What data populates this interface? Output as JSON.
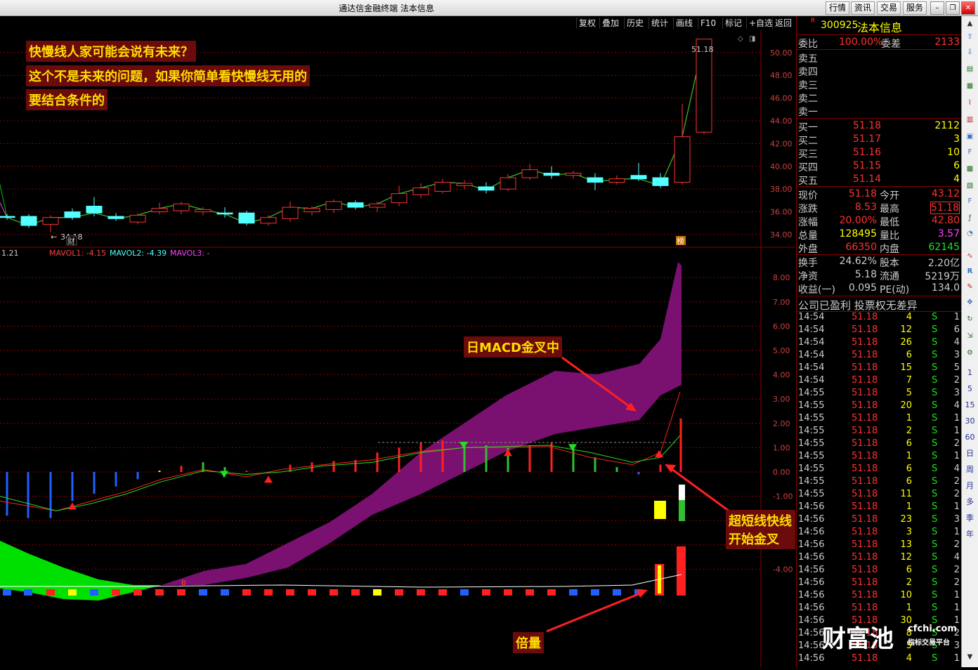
{
  "window": {
    "title": "通达信金融终端 法本信息"
  },
  "top_buttons": [
    "行情",
    "资讯",
    "交易",
    "服务"
  ],
  "toolbar": [
    "复权",
    "叠加",
    "历史",
    "统计",
    "画线",
    "F10",
    "标记",
    "+自选",
    "返回"
  ],
  "annotations": {
    "line1": "快慢线人家可能会说有未来？",
    "line2": "这个不是未来的问题，如果你简单看快慢线无用的",
    "line3": "要结合条件的",
    "macd": "日MACD金叉中",
    "short": "超短线快线开始金叉",
    "volume": "倍量"
  },
  "price_chart": {
    "high_label": "51.18",
    "low_label": "34.18",
    "y_ticks": [
      "50.00",
      "48.00",
      "46.00",
      "44.00",
      "42.00",
      "40.00",
      "38.00",
      "36.00",
      "34.00"
    ],
    "marker_left": "财",
    "marker_right": "榜",
    "candles": [
      {
        "o": 35.6,
        "c": 35.5,
        "h": 35.8,
        "l": 35.3
      },
      {
        "o": 35.6,
        "c": 34.8,
        "h": 35.8,
        "l": 34.6
      },
      {
        "o": 34.9,
        "c": 35.5,
        "h": 35.7,
        "l": 34.2
      },
      {
        "o": 36.0,
        "c": 35.5,
        "h": 36.3,
        "l": 35.3
      },
      {
        "o": 36.5,
        "c": 35.9,
        "h": 37.3,
        "l": 35.6
      },
      {
        "o": 35.6,
        "c": 35.4,
        "h": 35.9,
        "l": 35.2
      },
      {
        "o": 35.1,
        "c": 35.7,
        "h": 35.9,
        "l": 34.9
      },
      {
        "o": 36.0,
        "c": 36.3,
        "h": 36.8,
        "l": 35.8
      },
      {
        "o": 36.1,
        "c": 36.7,
        "h": 36.9,
        "l": 35.8
      },
      {
        "o": 36.0,
        "c": 36.2,
        "h": 36.4,
        "l": 35.7
      },
      {
        "o": 35.9,
        "c": 35.8,
        "h": 36.4,
        "l": 35.5
      },
      {
        "o": 35.9,
        "c": 35.0,
        "h": 36.1,
        "l": 34.8
      },
      {
        "o": 35.0,
        "c": 35.5,
        "h": 35.7,
        "l": 34.8
      },
      {
        "o": 35.4,
        "c": 36.4,
        "h": 36.9,
        "l": 35.1
      },
      {
        "o": 36.0,
        "c": 36.3,
        "h": 36.5,
        "l": 35.7
      },
      {
        "o": 36.2,
        "c": 36.9,
        "h": 37.1,
        "l": 35.9
      },
      {
        "o": 36.8,
        "c": 36.4,
        "h": 37.0,
        "l": 36.2
      },
      {
        "o": 36.4,
        "c": 36.7,
        "h": 36.9,
        "l": 36.0
      },
      {
        "o": 36.8,
        "c": 37.6,
        "h": 38.3,
        "l": 36.5
      },
      {
        "o": 37.5,
        "c": 38.1,
        "h": 38.5,
        "l": 37.2
      },
      {
        "o": 37.8,
        "c": 38.6,
        "h": 38.9,
        "l": 37.6
      },
      {
        "o": 38.3,
        "c": 38.5,
        "h": 38.8,
        "l": 38.0
      },
      {
        "o": 38.2,
        "c": 37.9,
        "h": 38.6,
        "l": 37.6
      },
      {
        "o": 38.0,
        "c": 39.0,
        "h": 39.3,
        "l": 37.8
      },
      {
        "o": 39.0,
        "c": 39.7,
        "h": 40.2,
        "l": 38.8
      },
      {
        "o": 39.4,
        "c": 39.2,
        "h": 40.0,
        "l": 38.9
      },
      {
        "o": 39.2,
        "c": 39.4,
        "h": 39.6,
        "l": 38.9
      },
      {
        "o": 39.0,
        "c": 38.6,
        "h": 39.4,
        "l": 37.9
      },
      {
        "o": 38.6,
        "c": 38.9,
        "h": 39.2,
        "l": 38.4
      },
      {
        "o": 39.2,
        "c": 38.9,
        "h": 40.3,
        "l": 38.7
      },
      {
        "o": 39.0,
        "c": 38.3,
        "h": 39.4,
        "l": 38.1
      },
      {
        "o": 38.6,
        "c": 42.6,
        "h": 45.5,
        "l": 38.4
      },
      {
        "o": 43.0,
        "c": 51.18,
        "h": 51.18,
        "l": 42.8
      }
    ]
  },
  "vol_panel": {
    "header_value": "1.21",
    "mavol1": "MAVOL1: -4.15",
    "mavol2": "MAVOL2: -4.39",
    "mavol3": "MAVOL3: -",
    "y_ticks": [
      "8.00",
      "7.00",
      "6.00",
      "5.00",
      "4.00",
      "3.00",
      "2.00",
      "1.00",
      "0.00",
      "-1.00",
      "-2.00",
      "-3.00",
      "-4.00"
    ],
    "b_label": "B"
  },
  "quote": {
    "code": "300925",
    "name": "法本信息",
    "r_mark": "R",
    "weibi_label": "委比",
    "weibi": "100.00%",
    "weicha_label": "委差",
    "weicha": "2133",
    "sells": [
      "卖五",
      "卖四",
      "卖三",
      "卖二",
      "卖一"
    ],
    "buys": [
      {
        "label": "买一",
        "price": "51.18",
        "vol": "2112"
      },
      {
        "label": "买二",
        "price": "51.17",
        "vol": "3"
      },
      {
        "label": "买三",
        "price": "51.16",
        "vol": "10"
      },
      {
        "label": "买四",
        "price": "51.15",
        "vol": "6"
      },
      {
        "label": "买五",
        "price": "51.14",
        "vol": "4"
      }
    ],
    "stats": [
      {
        "l1": "现价",
        "v1": "51.18",
        "l2": "今开",
        "v2": "43.12"
      },
      {
        "l1": "涨跌",
        "v1": "8.53",
        "l2": "最高",
        "v2": "51.18"
      },
      {
        "l1": "涨幅",
        "v1": "20.00%",
        "l2": "最低",
        "v2": "42.80"
      },
      {
        "l1": "总量",
        "v1": "128495",
        "l2": "量比",
        "v2": "3.57"
      },
      {
        "l1": "外盘",
        "v1": "66350",
        "l2": "内盘",
        "v2": "62145"
      }
    ],
    "finance": [
      {
        "l1": "换手",
        "v1": "24.62%",
        "l2": "股本",
        "v2": "2.20亿"
      },
      {
        "l1": "净资",
        "v1": "5.18",
        "l2": "流通",
        "v2": "5219万"
      },
      {
        "l1": "收益(一)",
        "v1": "0.095",
        "l2": "PE(动)",
        "v2": "134.0"
      }
    ],
    "note": "公司已盈利 投票权无差异"
  },
  "ticks": [
    {
      "t": "14:54",
      "p": "51.18",
      "v": "4",
      "s": "S",
      "n": "1"
    },
    {
      "t": "14:54",
      "p": "51.18",
      "v": "12",
      "s": "S",
      "n": "6"
    },
    {
      "t": "14:54",
      "p": "51.18",
      "v": "26",
      "s": "S",
      "n": "4"
    },
    {
      "t": "14:54",
      "p": "51.18",
      "v": "6",
      "s": "S",
      "n": "3"
    },
    {
      "t": "14:54",
      "p": "51.18",
      "v": "15",
      "s": "S",
      "n": "5"
    },
    {
      "t": "14:54",
      "p": "51.18",
      "v": "7",
      "s": "S",
      "n": "2"
    },
    {
      "t": "14:55",
      "p": "51.18",
      "v": "5",
      "s": "S",
      "n": "3"
    },
    {
      "t": "14:55",
      "p": "51.18",
      "v": "20",
      "s": "S",
      "n": "4"
    },
    {
      "t": "14:55",
      "p": "51.18",
      "v": "1",
      "s": "S",
      "n": "1"
    },
    {
      "t": "14:55",
      "p": "51.18",
      "v": "2",
      "s": "S",
      "n": "1"
    },
    {
      "t": "14:55",
      "p": "51.18",
      "v": "6",
      "s": "S",
      "n": "2"
    },
    {
      "t": "14:55",
      "p": "51.18",
      "v": "1",
      "s": "S",
      "n": "1"
    },
    {
      "t": "14:55",
      "p": "51.18",
      "v": "6",
      "s": "S",
      "n": "4"
    },
    {
      "t": "14:55",
      "p": "51.18",
      "v": "6",
      "s": "S",
      "n": "2"
    },
    {
      "t": "14:55",
      "p": "51.18",
      "v": "11",
      "s": "S",
      "n": "2"
    },
    {
      "t": "14:56",
      "p": "51.18",
      "v": "1",
      "s": "S",
      "n": "1"
    },
    {
      "t": "14:56",
      "p": "51.18",
      "v": "23",
      "s": "S",
      "n": "3"
    },
    {
      "t": "14:56",
      "p": "51.18",
      "v": "3",
      "s": "S",
      "n": "1"
    },
    {
      "t": "14:56",
      "p": "51.18",
      "v": "13",
      "s": "S",
      "n": "2"
    },
    {
      "t": "14:56",
      "p": "51.18",
      "v": "12",
      "s": "S",
      "n": "4"
    },
    {
      "t": "14:56",
      "p": "51.18",
      "v": "6",
      "s": "S",
      "n": "2"
    },
    {
      "t": "14:56",
      "p": "51.18",
      "v": "2",
      "s": "S",
      "n": "2"
    },
    {
      "t": "14:56",
      "p": "51.18",
      "v": "10",
      "s": "S",
      "n": "1"
    },
    {
      "t": "14:56",
      "p": "51.18",
      "v": "1",
      "s": "S",
      "n": "1"
    },
    {
      "t": "14:56",
      "p": "51.18",
      "v": "30",
      "s": "S",
      "n": "1"
    },
    {
      "t": "14:56",
      "p": "51.18",
      "v": "8",
      "s": "S",
      "n": "2"
    },
    {
      "t": "14:56",
      "p": "51.18",
      "v": "5",
      "s": "S",
      "n": "3"
    },
    {
      "t": "14:56",
      "p": "51.18",
      "v": "4",
      "s": "S",
      "n": "1"
    }
  ],
  "right_tabs": [
    "1",
    "5",
    "15",
    "30",
    "60",
    "日",
    "周",
    "月",
    "多",
    "季",
    "年"
  ],
  "watermark": {
    "main": "财富池",
    "site": "cfchi.com",
    "sub": "指标交易平台"
  },
  "colors": {
    "up": "#ff3232",
    "down": "#54ffff",
    "grid": "#8b0000",
    "yellow": "#ffff00",
    "purple": "#7a1070",
    "green": "#00e000"
  }
}
